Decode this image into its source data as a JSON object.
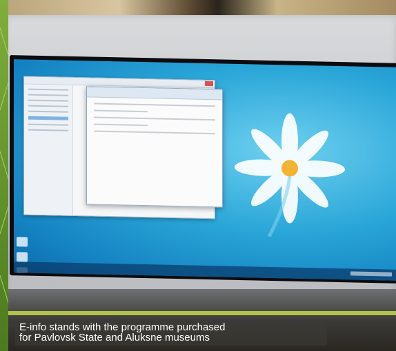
{
  "image": {
    "subject": "kiosk-touchscreen-photo",
    "desktop_wallpaper": "daisy-on-blue",
    "colors": {
      "wallpaper_blue": "#1a8fd0",
      "caption_text": "#ffffff",
      "green_accent": "#7fae3c"
    }
  },
  "caption": {
    "line1": "E-info stands with the programme purchased",
    "line2": "for Pavlovsk State and Aluksne museums"
  }
}
